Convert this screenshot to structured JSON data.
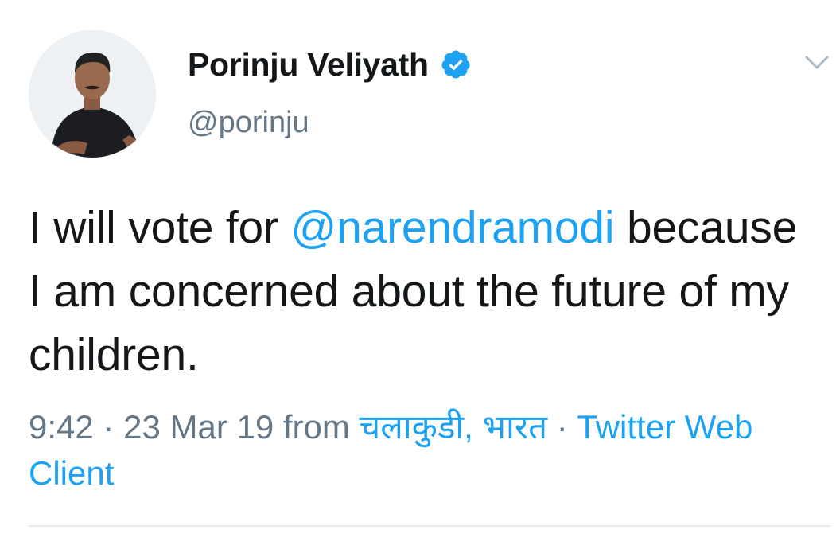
{
  "author": {
    "display_name": "Porinju Veliyath",
    "handle": "@porinju",
    "verified": true,
    "avatar_icon": "profile-photo"
  },
  "tweet": {
    "text_before": "I will vote for ",
    "mention": "@narendramodi",
    "text_after": " because I am concerned about the future of my children."
  },
  "meta": {
    "time": "9:42",
    "separator": "·",
    "date": "23 Mar 19",
    "from_label": "from",
    "location": "चलाकुडी, भारत",
    "client": "Twitter Web Client"
  },
  "icons": {
    "verified": "verified-badge-icon",
    "caret": "chevron-down-icon"
  },
  "colors": {
    "link": "#1da1f2",
    "muted": "#657786",
    "text": "#14171a"
  }
}
